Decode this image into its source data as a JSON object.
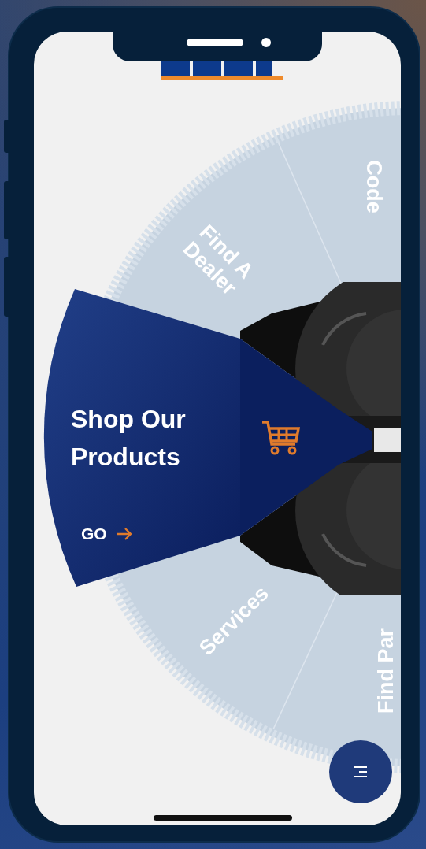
{
  "wheel": {
    "segments": [
      {
        "label": "Code",
        "selected": false
      },
      {
        "label": "Find A Dealer",
        "selected": false
      },
      {
        "label": "Shop Our Products",
        "selected": true,
        "action": "GO"
      },
      {
        "label": "Services",
        "selected": false
      },
      {
        "label": "Find Par",
        "selected": false
      }
    ]
  }
}
